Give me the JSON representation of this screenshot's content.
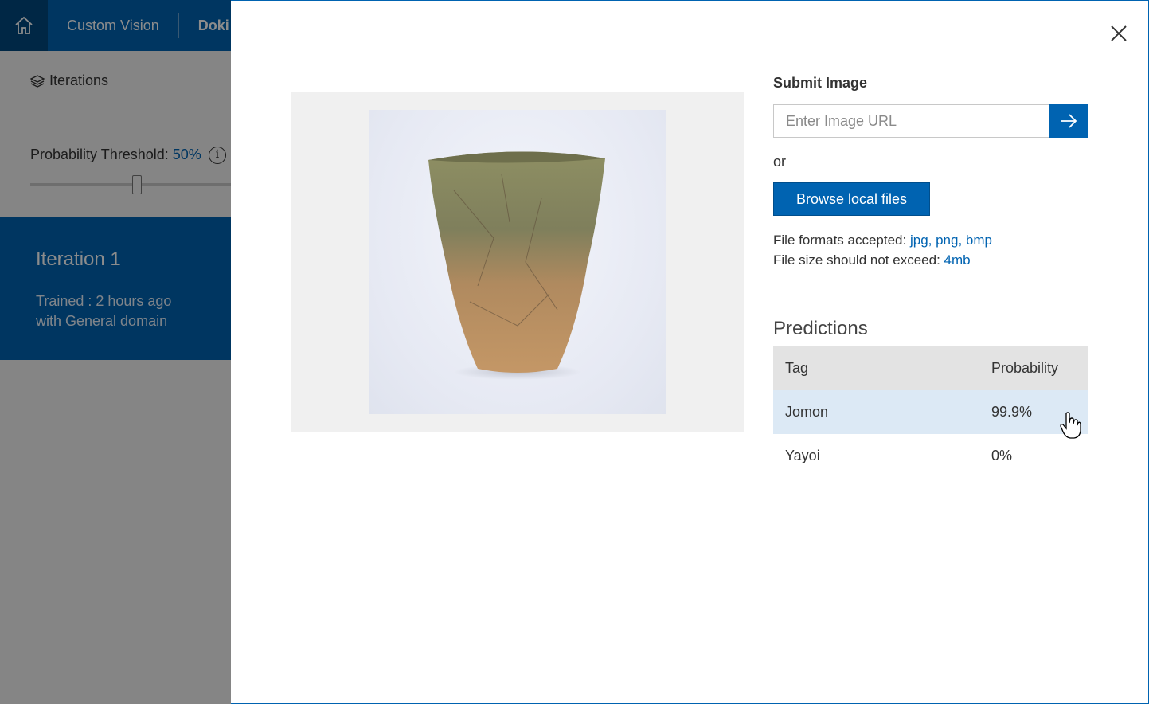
{
  "topbar": {
    "home_icon": "home-icon",
    "breadcrumb_app": "Custom Vision",
    "breadcrumb_project": "Doki"
  },
  "sidebar": {
    "iterations_icon": "layers-icon",
    "iterations_label": "Iterations",
    "threshold_label": "Probability Threshold: ",
    "threshold_value": "50%",
    "threshold_fraction": 0.5,
    "info_icon": "info-icon"
  },
  "iteration": {
    "name": "Iteration 1",
    "trained": "Trained : 2 hours ago",
    "domain": "with General domain"
  },
  "modal": {
    "close_icon": "close-icon",
    "submit_title": "Submit Image",
    "url_placeholder": "Enter Image URL",
    "go_icon": "arrow-right-icon",
    "or_text": "or",
    "browse_label": "Browse local files",
    "formats_label": "File formats accepted: ",
    "formats": [
      "jpg",
      "png",
      "bmp"
    ],
    "formats_text": "jpg, png, bmp",
    "size_label": "File size should not exceed: ",
    "size_value": "4mb",
    "predictions_title": "Predictions",
    "table_headers": [
      "Tag",
      "Probability"
    ],
    "predictions": [
      {
        "tag": "Jomon",
        "probability": "99.9%"
      },
      {
        "tag": "Yayoi",
        "probability": "0%"
      }
    ]
  },
  "colors": {
    "accent": "#0063b1",
    "accent_dark": "#00477f",
    "selected_row": "#dce9f5",
    "header_row": "#e3e3e3"
  }
}
